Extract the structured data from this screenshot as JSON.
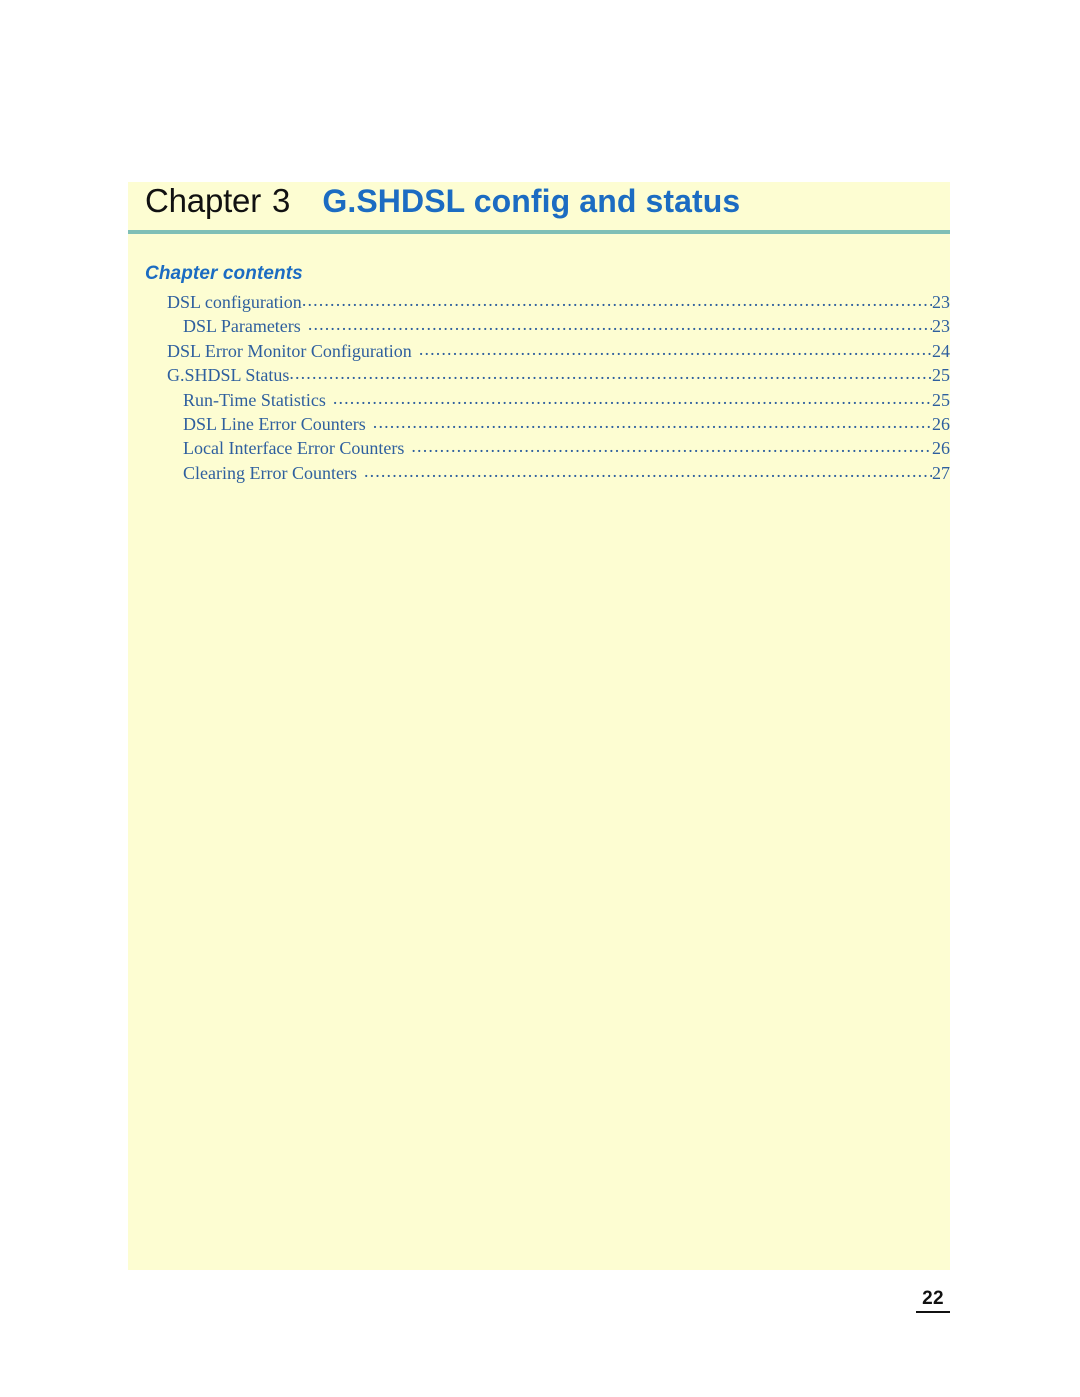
{
  "page": {
    "background_color": "#ffffff",
    "content_block_color": "#fdfdd2",
    "folio": "22"
  },
  "header": {
    "chapter_word": "Chapter",
    "chapter_number": "3",
    "title": "G.SHDSL config and status",
    "title_color": "#1c6cc2",
    "rule_color": "#7fbfb6"
  },
  "contents": {
    "heading": "Chapter contents",
    "heading_color": "#1c6cc2",
    "text_color": "#2e5f9e",
    "entries": [
      {
        "label": "DSL configuration",
        "page": "23",
        "level": 1,
        "spaced_leader": false
      },
      {
        "label": "DSL Parameters",
        "page": "23",
        "level": 2,
        "spaced_leader": true
      },
      {
        "label": "DSL Error Monitor Configuration",
        "page": "24",
        "level": 1,
        "spaced_leader": true
      },
      {
        "label": "G.SHDSL Status",
        "page": "25",
        "level": 1,
        "spaced_leader": false
      },
      {
        "label": "Run-Time Statistics",
        "page": "25",
        "level": 2,
        "spaced_leader": true
      },
      {
        "label": "DSL Line Error Counters",
        "page": "26",
        "level": 2,
        "spaced_leader": true
      },
      {
        "label": "Local Interface Error Counters",
        "page": "26",
        "level": 2,
        "spaced_leader": true
      },
      {
        "label": "Clearing Error Counters",
        "page": "27",
        "level": 2,
        "spaced_leader": true
      }
    ]
  }
}
